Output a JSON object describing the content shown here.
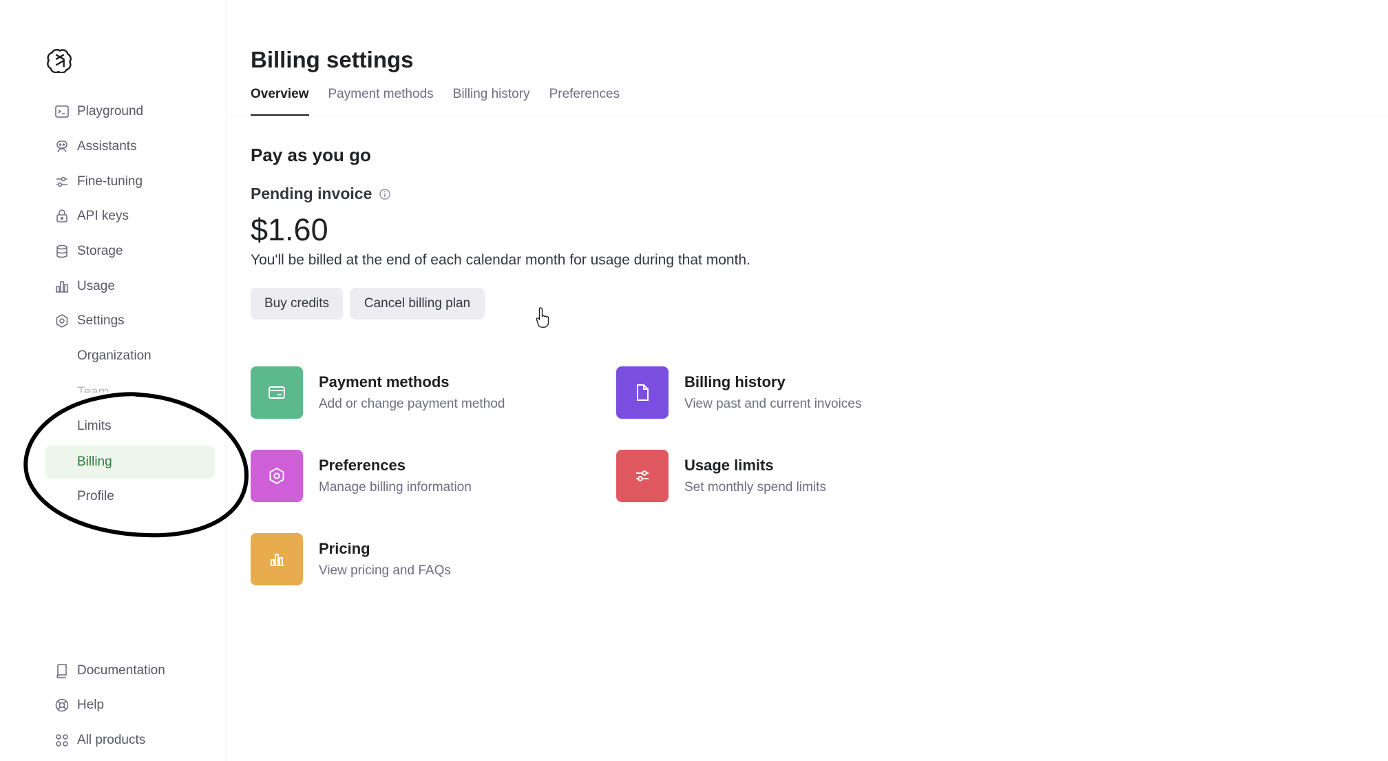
{
  "sidebar": {
    "logo_icon": "openai-logo-icon",
    "nav": [
      {
        "label": "Playground",
        "icon": "terminal-icon"
      },
      {
        "label": "Assistants",
        "icon": "assistant-icon"
      },
      {
        "label": "Fine-tuning",
        "icon": "sliders-icon"
      },
      {
        "label": "API keys",
        "icon": "lock-icon"
      },
      {
        "label": "Storage",
        "icon": "database-icon"
      },
      {
        "label": "Usage",
        "icon": "bar-chart-icon"
      },
      {
        "label": "Settings",
        "icon": "gear-icon"
      }
    ],
    "settings_sub": [
      {
        "label": "Organization"
      },
      {
        "label": "Team"
      },
      {
        "label": "Limits"
      },
      {
        "label": "Billing"
      },
      {
        "label": "Profile"
      }
    ],
    "bottom": [
      {
        "label": "Documentation",
        "icon": "book-icon"
      },
      {
        "label": "Help",
        "icon": "lifebuoy-icon"
      },
      {
        "label": "All products",
        "icon": "grid-icon"
      }
    ]
  },
  "header": {
    "title": "Billing settings",
    "tabs": [
      {
        "label": "Overview",
        "active": true
      },
      {
        "label": "Payment methods"
      },
      {
        "label": "Billing history"
      },
      {
        "label": "Preferences"
      }
    ]
  },
  "plan": {
    "title": "Pay as you go",
    "pending_label": "Pending invoice",
    "amount": "$1.60",
    "note": "You'll be billed at the end of each calendar month for usage during that month.",
    "buy_label": "Buy credits",
    "cancel_label": "Cancel billing plan"
  },
  "cards": [
    {
      "title": "Payment methods",
      "subtitle": "Add or change payment method",
      "icon": "credit-card-icon",
      "color": "#5bb98c"
    },
    {
      "title": "Billing history",
      "subtitle": "View past and current invoices",
      "icon": "document-icon",
      "color": "#7a4fe0"
    },
    {
      "title": "Preferences",
      "subtitle": "Manage billing information",
      "icon": "gear-icon",
      "color": "#cf5fd8"
    },
    {
      "title": "Usage limits",
      "subtitle": "Set monthly spend limits",
      "icon": "sliders-icon",
      "color": "#e0585f"
    },
    {
      "title": "Pricing",
      "subtitle": "View pricing and FAQs",
      "icon": "bar-chart-icon",
      "color": "#e8ac4e"
    }
  ],
  "colors": {
    "active_bg": "#ecf6ea",
    "active_text": "#2a7a3b",
    "annotation": "#000000"
  }
}
